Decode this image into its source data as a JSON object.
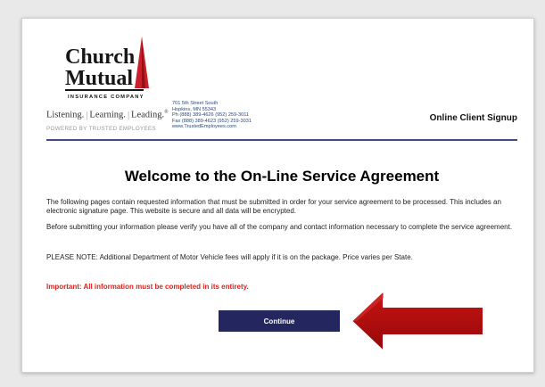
{
  "logo": {
    "line1": "Church",
    "line2": "Mutual",
    "subtitle": "INSURANCE COMPANY"
  },
  "tagline": {
    "items": [
      "Listening.",
      "Learning.",
      "Leading."
    ],
    "mark": "®"
  },
  "powered_by": "POWERED BY TRUSTED EMPLOYEES",
  "address": {
    "street": "701 5th Street South",
    "city": "Hopkins, MN 55343",
    "phone": "Ph (888) 389-4626 (952) 259-3011",
    "fax": "Fax (888) 389-4623 (952) 259-3031",
    "web": "www.TrustedEmployees.com"
  },
  "header_right": "Online Client Signup",
  "page_title": "Welcome to the On-Line Service Agreement",
  "paragraphs": [
    "The following pages contain requested information that must be submitted in order for your service agreement to be processed. This includes an electronic signature page. This website is secure and all data will be encrypted.",
    "Before submitting your information please verify you have all of the company and contact information necessary to complete the service agreement.",
    "PLEASE NOTE: Additional Department of Motor Vehicle fees will apply if it is on the package. Price varies per State."
  ],
  "important_note": "Important: All information must be completed in its entirety.",
  "continue_label": "Continue",
  "colors": {
    "navy": "#24275f",
    "rule": "#3f4d80",
    "logo_red": "#c8202a",
    "important_red": "#e0201b",
    "arrow_red": "#b40d0d"
  }
}
